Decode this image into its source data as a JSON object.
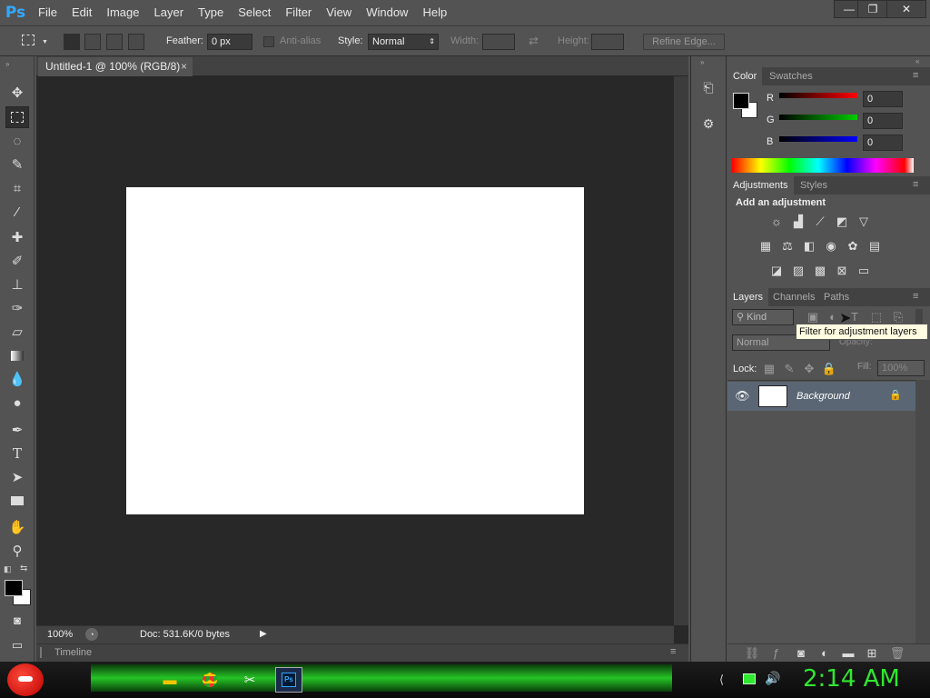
{
  "app": {
    "logo": "Ps"
  },
  "menu": [
    "File",
    "Edit",
    "Image",
    "Layer",
    "Type",
    "Select",
    "Filter",
    "View",
    "Window",
    "Help"
  ],
  "window_controls": {
    "minimize": "—",
    "restore": "❐",
    "close": "✕"
  },
  "options": {
    "feather_label": "Feather:",
    "feather_value": "0 px",
    "antialias_label": "Anti-alias",
    "style_label": "Style:",
    "style_value": "Normal",
    "width_label": "Width:",
    "height_label": "Height:",
    "refine_label": "Refine Edge..."
  },
  "document": {
    "tab_title": "Untitled-1 @ 100% (RGB/8)",
    "tab_close": "×",
    "zoom": "100%",
    "doc_info": "Doc: 531.6K/0 bytes",
    "timeline": "Timeline"
  },
  "color_panel": {
    "tabs": [
      "Color",
      "Swatches"
    ],
    "sliders": [
      {
        "label": "R",
        "value": "0"
      },
      {
        "label": "G",
        "value": "0"
      },
      {
        "label": "B",
        "value": "0"
      }
    ]
  },
  "adjustments_panel": {
    "tabs": [
      "Adjustments",
      "Styles"
    ],
    "heading": "Add an adjustment"
  },
  "layers_panel": {
    "tabs": [
      "Layers",
      "Channels",
      "Paths"
    ],
    "kind": "Kind",
    "blend": "Normal",
    "opacity_label": "Opacity:",
    "lock_label": "Lock:",
    "fill_label": "Fill:",
    "fill_value": "100%",
    "layer_name": "Background",
    "tooltip": "Filter for adjustment layers"
  },
  "taskbar": {
    "clock": "2:14 AM"
  },
  "colors": {
    "accent": "#31a8ff",
    "clock": "#2fe82f",
    "canvas": "#ffffff"
  }
}
